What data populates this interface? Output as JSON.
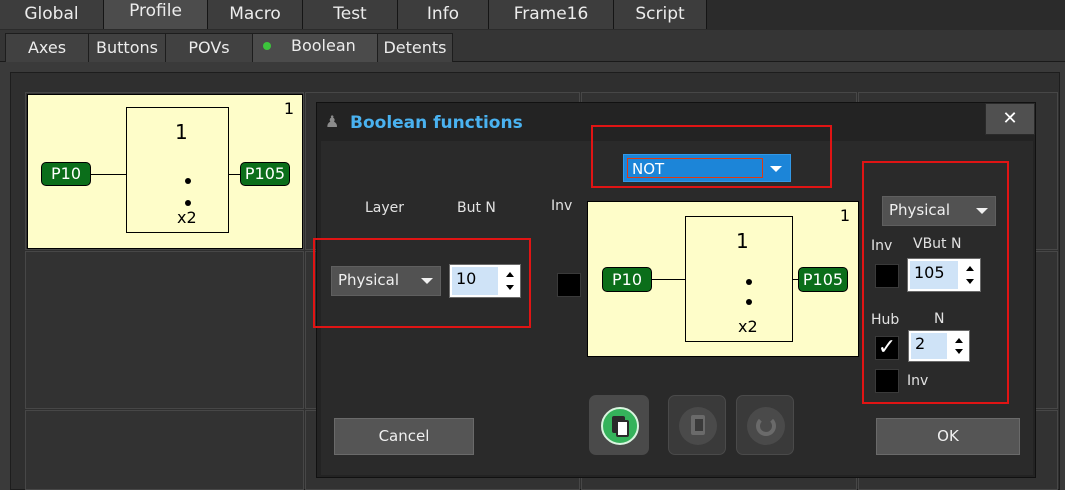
{
  "main_tabs": [
    "Global",
    "Profile",
    "Macro",
    "Test",
    "Info",
    "Frame16",
    "Script"
  ],
  "sub_tabs": [
    "Axes",
    "Buttons",
    "POVs",
    "Boolean",
    "Detents"
  ],
  "background_diagram": {
    "number": "1",
    "gate_top": "1",
    "gate_bottom": "x2",
    "input": "P10",
    "output": "P105"
  },
  "dialog": {
    "title": "Boolean functions",
    "close_symbol": "✕",
    "function_select": "NOT",
    "layer_label": "Layer",
    "butn_label": "But N",
    "inv_label": "Inv",
    "layer_select": "Physical",
    "butn_value": "10",
    "diagram": {
      "number": "1",
      "gate_top": "1",
      "gate_bottom": "x2",
      "input": "P10",
      "output": "P105"
    },
    "right_panel": {
      "layer_select": "Physical",
      "inv_label": "Inv",
      "vbutn_label": "VBut N",
      "vbutn_value": "105",
      "hub_label": "Hub",
      "n_label": "N",
      "hub_checked": "✓",
      "n_value": "2",
      "inv2_label": "Inv"
    },
    "cancel_label": "Cancel",
    "ok_label": "OK"
  },
  "colors": {
    "accent_blue": "#1c85d8",
    "title_blue": "#4ab2f0",
    "port_green": "#0b6e1a",
    "diagram_bg": "#fefdc9",
    "highlight_red": "#e01414"
  }
}
